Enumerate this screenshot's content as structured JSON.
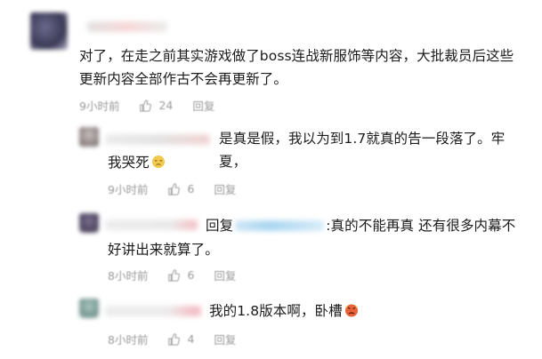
{
  "comments": [
    {
      "text_line1": "对了，在走之前其实游戏做了boss连战新服饰等内容，大批裁员后这些",
      "text_line2": "更新内容全部作古不会再更新了。",
      "time": "9小时前",
      "likes": "24",
      "reply": "回复"
    },
    {
      "text_line1": "是真是假，我以为到1.7就真的告一段落了。牢夏，",
      "text_line2": "我哭死",
      "time": "9小时前",
      "likes": "6",
      "reply": "回复"
    },
    {
      "reply_prefix": "回复",
      "text_line1": ":真的不能再真 还有很多内幕不",
      "text_line2": "好讲出来就算了。",
      "time": "8小时前",
      "likes": "6",
      "reply": "回复"
    },
    {
      "text_line1": "我的1.8版本啊，卧槽",
      "time": "8小时前",
      "likes": "4",
      "reply": "回复"
    }
  ],
  "colors": {
    "text": "#1b1b1b",
    "meta": "#9a9a9a",
    "mention": "#6cb6e3"
  },
  "icons": [
    "thumb-up-icon",
    "sad-emoji-icon",
    "angry-emoji-icon"
  ]
}
